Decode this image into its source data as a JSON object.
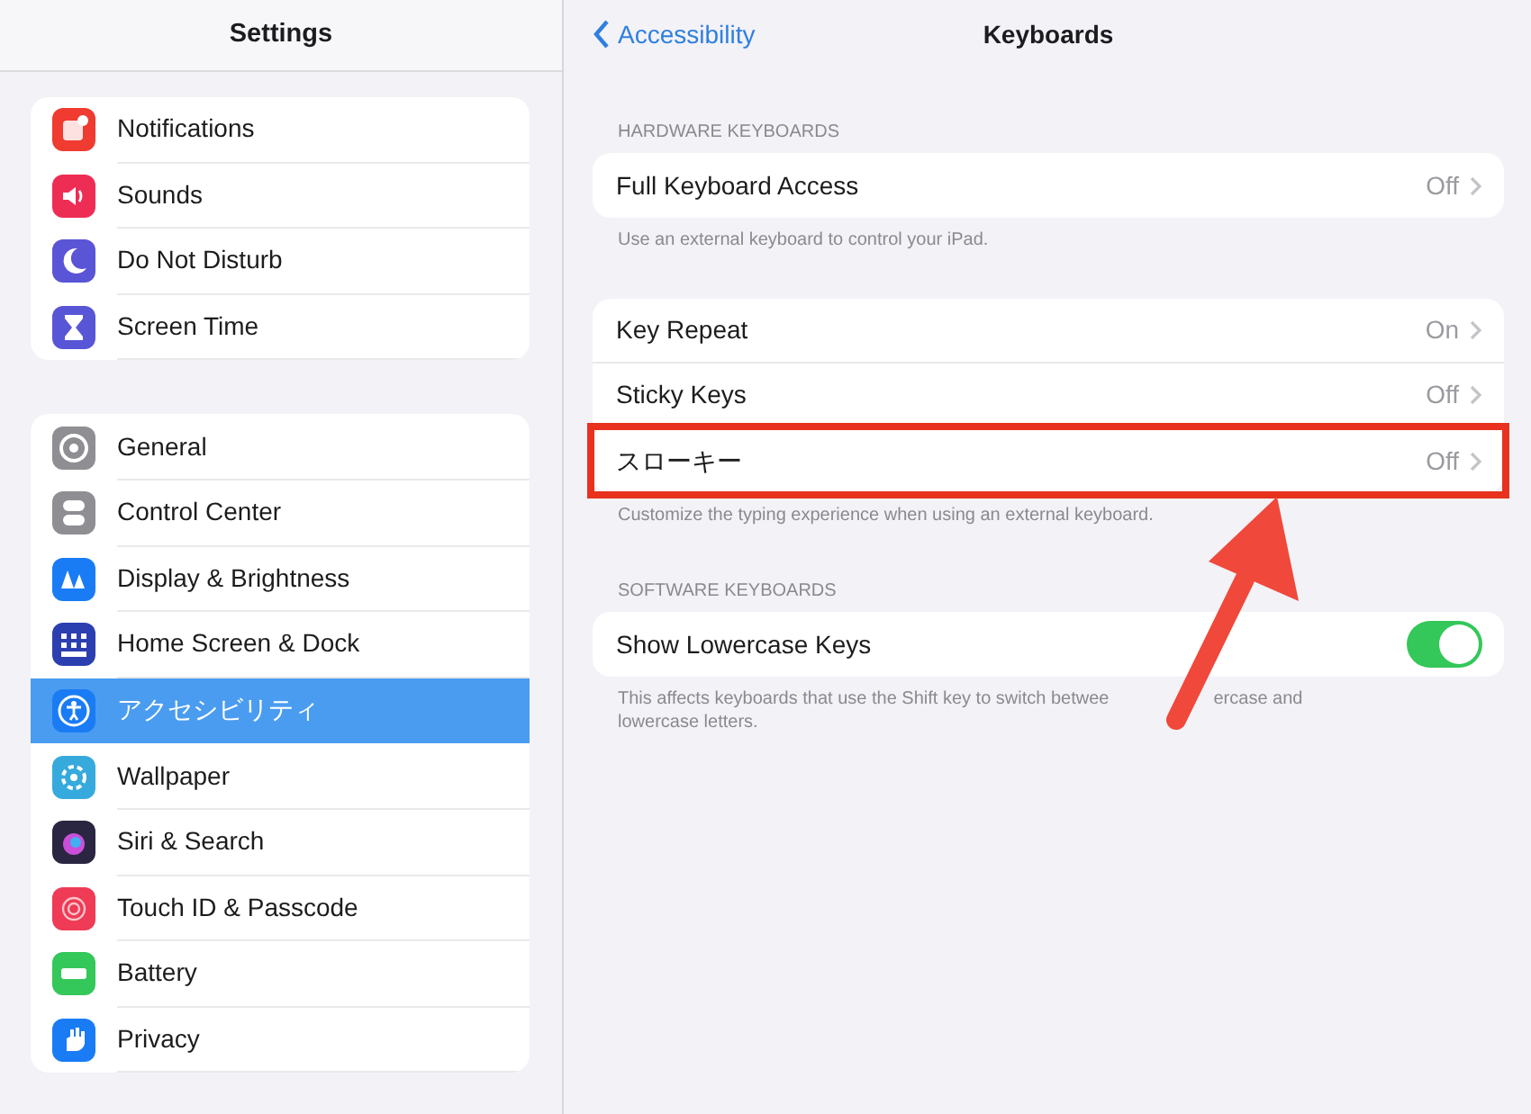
{
  "sidebar": {
    "title": "Settings",
    "groups": [
      [
        {
          "label": "Notifications",
          "color": "#ef3b30",
          "selected": false
        },
        {
          "label": "Sounds",
          "color": "#ee2d55",
          "selected": false
        },
        {
          "label": "Do Not Disturb",
          "color": "#5a55d6",
          "selected": false
        },
        {
          "label": "Screen Time",
          "color": "#5856d6",
          "selected": false
        }
      ],
      [
        {
          "label": "General",
          "color": "#8e8e93",
          "selected": false
        },
        {
          "label": "Control Center",
          "color": "#8e8e93",
          "selected": false
        },
        {
          "label": "Display & Brightness",
          "color": "#1a7cf5",
          "selected": false
        },
        {
          "label": "Home Screen & Dock",
          "color": "#2c3fb0",
          "selected": false
        },
        {
          "label": "アクセシビリティ",
          "color": "#1a7cf5",
          "selected": true
        },
        {
          "label": "Wallpaper",
          "color": "#36aadc",
          "selected": false
        },
        {
          "label": "Siri & Search",
          "color": "#2a2540",
          "selected": false
        },
        {
          "label": "Touch ID & Passcode",
          "color": "#ef3b55",
          "selected": false
        },
        {
          "label": "Battery",
          "color": "#34c759",
          "selected": false
        },
        {
          "label": "Privacy",
          "color": "#1a7cf5",
          "selected": false
        }
      ]
    ]
  },
  "detail": {
    "back": "Accessibility",
    "title": "Keyboards",
    "sections": [
      {
        "header": "HARDWARE KEYBOARDS",
        "rows": [
          {
            "kind": "value",
            "label": "Full Keyboard Access",
            "value": "Off",
            "highlighted": false
          }
        ],
        "footer": [
          "Use an external keyboard to control your iPad."
        ]
      },
      {
        "rows": [
          {
            "kind": "value",
            "label": "Key Repeat",
            "value": "On",
            "highlighted": false
          },
          {
            "kind": "value",
            "label": "Sticky Keys",
            "value": "Off",
            "highlighted": false
          },
          {
            "kind": "value",
            "label": "スローキー",
            "value": "Off",
            "highlighted": true
          }
        ],
        "footer": [
          "Customize the typing experience when using an external keyboard."
        ]
      },
      {
        "header": "SOFTWARE KEYBOARDS",
        "rows": [
          {
            "kind": "toggle",
            "label": "Show Lowercase Keys",
            "on": true,
            "highlighted": false
          }
        ],
        "footer": [
          "This affects keyboards that use the Shift key to switch betwee",
          "ercase and",
          "lowercase letters."
        ]
      }
    ]
  },
  "annotations": [
    {
      "kind": "arrow"
    }
  ]
}
